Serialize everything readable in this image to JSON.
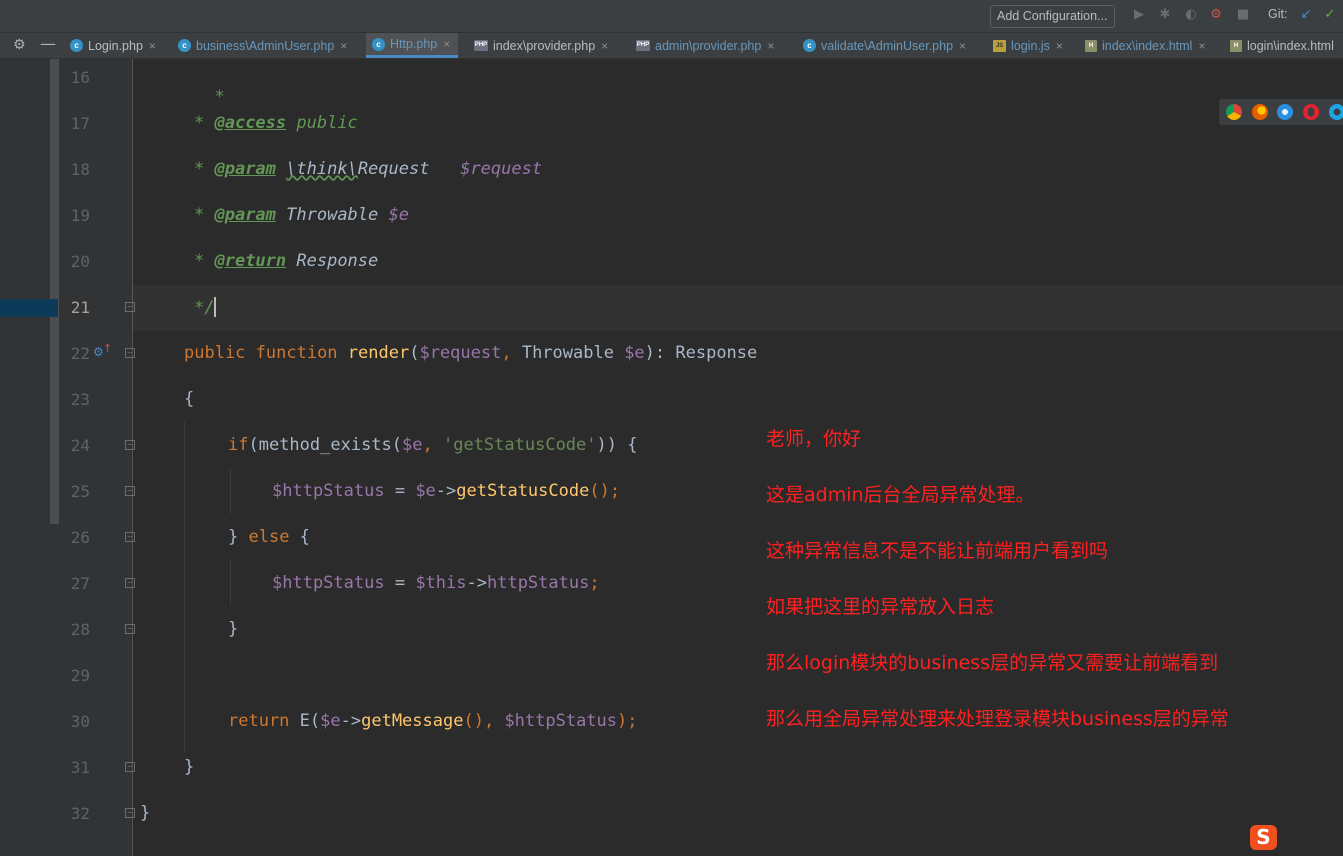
{
  "toolbar": {
    "add_configuration_label": "Add Configuration...",
    "git_label": "Git:"
  },
  "tabs": [
    {
      "label": "Login.php",
      "icon": "php-class-icon",
      "modified": false,
      "active": false
    },
    {
      "label": "business\\AdminUser.php",
      "icon": "php-class-icon",
      "modified": true,
      "active": false
    },
    {
      "label": "Http.php",
      "icon": "php-class-icon",
      "modified": true,
      "active": true
    },
    {
      "label": "index\\provider.php",
      "icon": "php-file-icon",
      "modified": false,
      "active": false
    },
    {
      "label": "admin\\provider.php",
      "icon": "php-file-icon",
      "modified": true,
      "active": false
    },
    {
      "label": "validate\\AdminUser.php",
      "icon": "php-class-icon",
      "modified": true,
      "active": false
    },
    {
      "label": "login.js",
      "icon": "js-file-icon",
      "modified": true,
      "active": false
    },
    {
      "label": "index\\index.html",
      "icon": "html-file-icon",
      "modified": true,
      "active": false
    },
    {
      "label": "login\\index.html",
      "icon": "html-file-icon",
      "modified": false,
      "active": false
    }
  ],
  "editor": {
    "current_line": 21,
    "line_numbers": [
      "16",
      "17",
      "18",
      "19",
      "20",
      "21",
      "22",
      "23",
      "24",
      "25",
      "26",
      "27",
      "28",
      "29",
      "30",
      "31",
      "32"
    ],
    "code": {
      "l16_star": "*",
      "l17_star": "* ",
      "l17_tag": "@access",
      "l17_val": " public",
      "l18_star": "* ",
      "l18_tag": "@param",
      "l18_sp": " ",
      "l18_ns": "\\think\\",
      "l18_type": "Request",
      "l18_gap": "   ",
      "l18_var": "$request",
      "l19_star": "* ",
      "l19_tag": "@param",
      "l19_type": " Throwable ",
      "l19_var": "$e",
      "l20_star": "* ",
      "l20_tag": "@return",
      "l20_type": " Response",
      "l21_close": "*/",
      "l22_public": "public",
      "l22_function": " function ",
      "l22_name": "render",
      "l22_open": "(",
      "l22_arg1": "$request",
      "l22_comma": ", ",
      "l22_type": "Throwable ",
      "l22_arg2": "$e",
      "l22_ret": "): Response",
      "l23_brace": "{",
      "l24_if": "if",
      "l24_call": "(method_exists(",
      "l24_var": "$e",
      "l24_comma": ", ",
      "l24_str": "'getStatusCode'",
      "l24_end": ")) {",
      "l25_var": "$httpStatus",
      "l25_eq": " = ",
      "l25_e": "$e",
      "l25_arrow": "->",
      "l25_method": "getStatusCode",
      "l25_end": "();",
      "l26_close": "} ",
      "l26_else": "else",
      "l26_open": " {",
      "l27_var": "$httpStatus",
      "l27_eq": " = ",
      "l27_this": "$this",
      "l27_arrow": "->",
      "l27_prop": "httpStatus",
      "l27_end": ";",
      "l28_brace": "}",
      "l30_return": "return",
      "l30_fn": " E(",
      "l30_e": "$e",
      "l30_arrow": "->",
      "l30_method": "getMessage",
      "l30_mid": "(), ",
      "l30_var": "$httpStatus",
      "l30_end": ");",
      "l31_brace": "}",
      "l32_brace": "}"
    }
  },
  "annotation": {
    "lines": [
      "老师，你好",
      "这是admin后台全局异常处理。",
      "这种异常信息不是不能让前端用户看到吗",
      "如果把这里的异常放入日志",
      "那么login模块的business层的异常又需要让前端看到",
      "那么用全局异常处理来处理登录模块business层的异常"
    ],
    "color": "#ff2020"
  },
  "browsers": [
    "chrome-icon",
    "firefox-icon",
    "safari-icon",
    "opera-icon",
    "ie-icon"
  ],
  "sogou_label": "S"
}
